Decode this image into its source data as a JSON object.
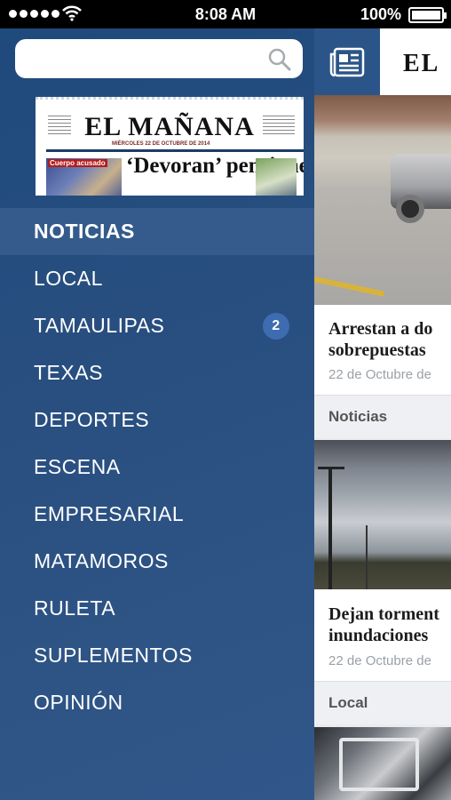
{
  "status_bar": {
    "time": "8:08 AM",
    "battery": "100%",
    "battery_level": 1.0
  },
  "sidebar": {
    "search": {
      "placeholder": "",
      "value": ""
    },
    "cover": {
      "masthead": "EL MAÑANA",
      "subline": "MIÉRCOLES 22 DE OCTUBRE DE 2014",
      "photo_label": "Cuerpo acusado",
      "headline": "‘Devoran’ pensiones"
    },
    "items": [
      {
        "label": "NOTICIAS",
        "active": true
      },
      {
        "label": "LOCAL"
      },
      {
        "label": "TAMAULIPAS",
        "badge": "2"
      },
      {
        "label": "TEXAS"
      },
      {
        "label": "DEPORTES"
      },
      {
        "label": "ESCENA"
      },
      {
        "label": "EMPRESARIAL"
      },
      {
        "label": "MATAMOROS"
      },
      {
        "label": "RULETA"
      },
      {
        "label": "SUPLEMENTOS"
      },
      {
        "label": "OPINIÓN"
      }
    ]
  },
  "main": {
    "header_title": "EL",
    "articles": [
      {
        "title_line1": "Arrestan a do",
        "title_line2": "sobrepuestas",
        "date": "22 de Octubre de",
        "category": "Noticias"
      },
      {
        "title_line1": "Dejan torment",
        "title_line2": "inundaciones",
        "date": "22 de Octubre de",
        "category": "Local"
      }
    ]
  },
  "colors": {
    "sidebar_bg": "#2b5283",
    "active_item_bg": "#345b8c",
    "badge_bg": "#3e6cb0",
    "header_toggle_bg": "#2b5588"
  },
  "icons": {
    "search": "search-icon",
    "newspaper": "newspaper-icon",
    "wifi": "wifi-icon",
    "battery": "battery-icon"
  }
}
